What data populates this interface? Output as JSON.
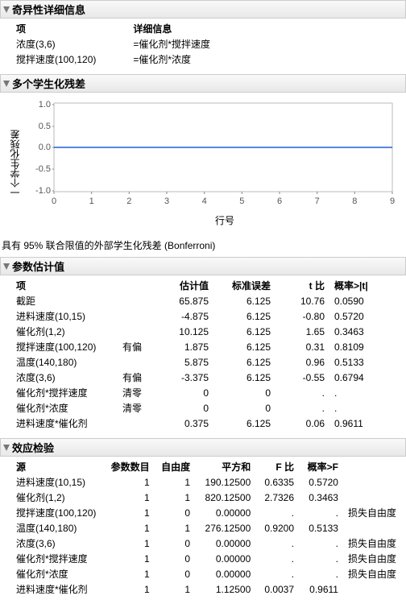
{
  "singularity": {
    "title": "奇异性详细信息",
    "col_term": "项",
    "col_detail": "详细信息",
    "rows": [
      {
        "term": "浓度(3,6)",
        "detail": "=催化剂*搅拌速度"
      },
      {
        "term": "搅拌速度(100,120)",
        "detail": "=催化剂*浓度"
      }
    ]
  },
  "residuals": {
    "title": "多个学生化残差",
    "ylabel": "一个学生化残差",
    "xlabel": "行号",
    "caption": "具有 95% 联合限值的外部学生化残差 (Bonferroni)"
  },
  "chart_data": {
    "type": "line",
    "title": "多个学生化残差",
    "xlabel": "行号",
    "ylabel": "一个学生化残差",
    "xlim": [
      0,
      9
    ],
    "ylim": [
      -1.0,
      1.0
    ],
    "xticks": [
      0,
      1,
      2,
      3,
      4,
      5,
      6,
      7,
      8,
      9
    ],
    "yticks": [
      -1.0,
      -0.5,
      0.0,
      0.5,
      1.0
    ],
    "series": [
      {
        "name": "外部学生化残差",
        "x": [
          0,
          9
        ],
        "values": [
          0,
          0
        ]
      }
    ]
  },
  "estimates": {
    "title": "参数估计值",
    "headers": {
      "term": "项",
      "flag": "",
      "est": "估计值",
      "se": "标准误差",
      "t": "t 比",
      "p": "概率>|t|"
    },
    "rows": [
      {
        "term": "截距",
        "flag": "",
        "est": "65.875",
        "se": "6.125",
        "t": "10.76",
        "p": "0.0590"
      },
      {
        "term": "进料速度(10,15)",
        "flag": "",
        "est": "-4.875",
        "se": "6.125",
        "t": "-0.80",
        "p": "0.5720"
      },
      {
        "term": "催化剂(1,2)",
        "flag": "",
        "est": "10.125",
        "se": "6.125",
        "t": "1.65",
        "p": "0.3463"
      },
      {
        "term": "搅拌速度(100,120)",
        "flag": "有偏",
        "est": "1.875",
        "se": "6.125",
        "t": "0.31",
        "p": "0.8109"
      },
      {
        "term": "温度(140,180)",
        "flag": "",
        "est": "5.875",
        "se": "6.125",
        "t": "0.96",
        "p": "0.5133"
      },
      {
        "term": "浓度(3,6)",
        "flag": "有偏",
        "est": "-3.375",
        "se": "6.125",
        "t": "-0.55",
        "p": "0.6794"
      },
      {
        "term": "催化剂*搅拌速度",
        "flag": "清零",
        "est": "0",
        "se": "0",
        "t": ".",
        "p": "."
      },
      {
        "term": "催化剂*浓度",
        "flag": "清零",
        "est": "0",
        "se": "0",
        "t": ".",
        "p": "."
      },
      {
        "term": "进料速度*催化剂",
        "flag": "",
        "est": "0.375",
        "se": "6.125",
        "t": "0.06",
        "p": "0.9611"
      }
    ]
  },
  "effects": {
    "title": "效应检验",
    "headers": {
      "source": "源",
      "nparm": "参数数目",
      "df": "自由度",
      "ss": "平方和",
      "f": "F 比",
      "p": "概率>F",
      "note": ""
    },
    "rows": [
      {
        "source": "进料速度(10,15)",
        "nparm": "1",
        "df": "1",
        "ss": "190.12500",
        "f": "0.6335",
        "p": "0.5720",
        "note": ""
      },
      {
        "source": "催化剂(1,2)",
        "nparm": "1",
        "df": "1",
        "ss": "820.12500",
        "f": "2.7326",
        "p": "0.3463",
        "note": ""
      },
      {
        "source": "搅拌速度(100,120)",
        "nparm": "1",
        "df": "0",
        "ss": "0.00000",
        "f": ".",
        "p": ".",
        "note": "损失自由度"
      },
      {
        "source": "温度(140,180)",
        "nparm": "1",
        "df": "1",
        "ss": "276.12500",
        "f": "0.9200",
        "p": "0.5133",
        "note": ""
      },
      {
        "source": "浓度(3,6)",
        "nparm": "1",
        "df": "0",
        "ss": "0.00000",
        "f": ".",
        "p": ".",
        "note": "损失自由度"
      },
      {
        "source": "催化剂*搅拌速度",
        "nparm": "1",
        "df": "0",
        "ss": "0.00000",
        "f": ".",
        "p": ".",
        "note": "损失自由度"
      },
      {
        "source": "催化剂*浓度",
        "nparm": "1",
        "df": "0",
        "ss": "0.00000",
        "f": ".",
        "p": ".",
        "note": "损失自由度"
      },
      {
        "source": "进料速度*催化剂",
        "nparm": "1",
        "df": "1",
        "ss": "1.12500",
        "f": "0.0037",
        "p": "0.9611",
        "note": ""
      }
    ]
  }
}
